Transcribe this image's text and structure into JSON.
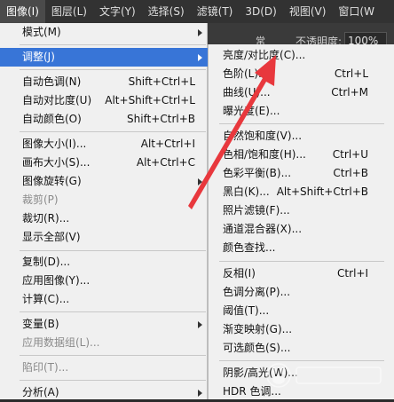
{
  "menubar": {
    "items": [
      {
        "label": "图像(I)",
        "active": true
      },
      {
        "label": "图层(L)",
        "active": false
      },
      {
        "label": "文字(Y)",
        "active": false
      },
      {
        "label": "选择(S)",
        "active": false
      },
      {
        "label": "滤镜(T)",
        "active": false
      },
      {
        "label": "3D(D)",
        "active": false
      },
      {
        "label": "视图(V)",
        "active": false
      },
      {
        "label": "窗口(W",
        "active": false
      }
    ]
  },
  "optionsbar": {
    "dropdown_fragment": "常",
    "opacity_label": "不透明度:",
    "opacity_value": "100%"
  },
  "image_menu": {
    "items": [
      {
        "label": "模式(M)",
        "shortcut": "",
        "submenu": true
      },
      {
        "label": "调整(J)",
        "shortcut": "",
        "submenu": true,
        "highlighted": true
      },
      {
        "label": "自动色调(N)",
        "shortcut": "Shift+Ctrl+L"
      },
      {
        "label": "自动对比度(U)",
        "shortcut": "Alt+Shift+Ctrl+L"
      },
      {
        "label": "自动颜色(O)",
        "shortcut": "Shift+Ctrl+B"
      },
      {
        "label": "图像大小(I)...",
        "shortcut": "Alt+Ctrl+I"
      },
      {
        "label": "画布大小(S)...",
        "shortcut": "Alt+Ctrl+C"
      },
      {
        "label": "图像旋转(G)",
        "shortcut": "",
        "submenu": true
      },
      {
        "label": "裁剪(P)",
        "shortcut": "",
        "disabled": true
      },
      {
        "label": "裁切(R)...",
        "shortcut": ""
      },
      {
        "label": "显示全部(V)",
        "shortcut": ""
      },
      {
        "label": "复制(D)...",
        "shortcut": ""
      },
      {
        "label": "应用图像(Y)...",
        "shortcut": ""
      },
      {
        "label": "计算(C)...",
        "shortcut": ""
      },
      {
        "label": "变量(B)",
        "shortcut": "",
        "submenu": true
      },
      {
        "label": "应用数据组(L)...",
        "shortcut": "",
        "disabled": true
      },
      {
        "label": "陷印(T)...",
        "shortcut": "",
        "disabled": true
      },
      {
        "label": "分析(A)",
        "shortcut": "",
        "submenu": true
      }
    ]
  },
  "adjust_submenu": {
    "items": [
      {
        "label": "亮度/对比度(C)...",
        "shortcut": ""
      },
      {
        "label": "色阶(L)...",
        "shortcut": "Ctrl+L"
      },
      {
        "label": "曲线(U)...",
        "shortcut": "Ctrl+M"
      },
      {
        "label": "曝光度(E)...",
        "shortcut": ""
      },
      {
        "label": "自然饱和度(V)...",
        "shortcut": ""
      },
      {
        "label": "色相/饱和度(H)...",
        "shortcut": "Ctrl+U"
      },
      {
        "label": "色彩平衡(B)...",
        "shortcut": "Ctrl+B"
      },
      {
        "label": "黑白(K)...",
        "shortcut": "Alt+Shift+Ctrl+B"
      },
      {
        "label": "照片滤镜(F)...",
        "shortcut": ""
      },
      {
        "label": "通道混合器(X)...",
        "shortcut": ""
      },
      {
        "label": "颜色查找...",
        "shortcut": ""
      },
      {
        "label": "反相(I)",
        "shortcut": "Ctrl+I"
      },
      {
        "label": "色调分离(P)...",
        "shortcut": ""
      },
      {
        "label": "阈值(T)...",
        "shortcut": ""
      },
      {
        "label": "渐变映射(G)...",
        "shortcut": ""
      },
      {
        "label": "可选颜色(S)...",
        "shortcut": ""
      },
      {
        "label": "阴影/高光(W)...",
        "shortcut": ""
      },
      {
        "label": "HDR 色调...",
        "shortcut": ""
      }
    ]
  },
  "colors": {
    "menubar_bg": "#323232",
    "menu_bg": "#f0f0f0",
    "highlight": "#3875d7",
    "annotation_arrow": "#e8383d"
  }
}
